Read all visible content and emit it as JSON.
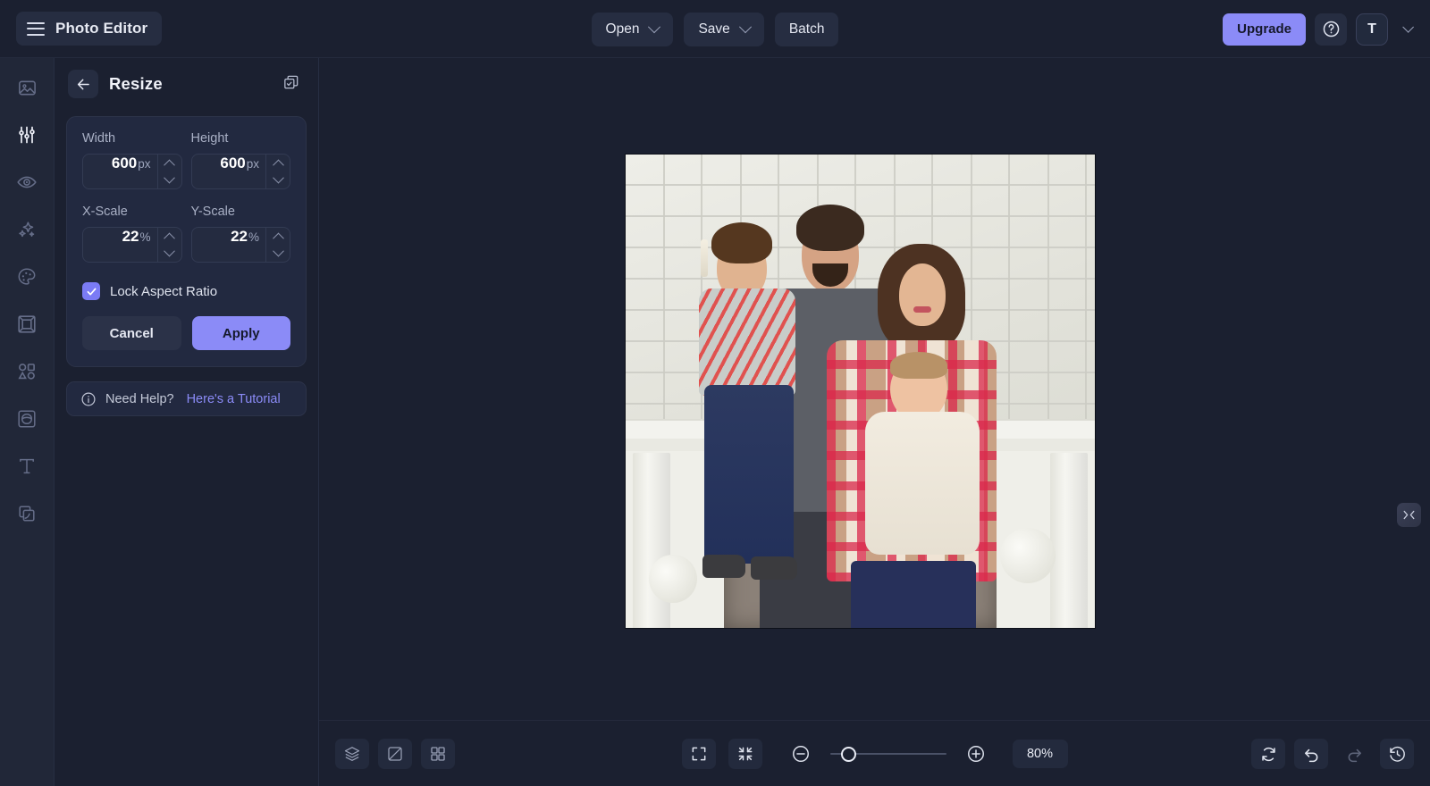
{
  "app": {
    "title": "Photo Editor",
    "accent": "#8b8bf7",
    "background": "#1b2030",
    "panel_bg": "#222940"
  },
  "topbar": {
    "menu_icon": "hamburger-icon",
    "brand_label": "Photo Editor",
    "buttons": [
      {
        "label": "Open",
        "has_chevron": true
      },
      {
        "label": "Save",
        "has_chevron": true
      },
      {
        "label": "Batch",
        "has_chevron": false
      }
    ],
    "upgrade_label": "Upgrade",
    "help_icon": "question-circle-icon",
    "avatar_initial": "T",
    "account_chevron": "chevron-down-icon"
  },
  "rail": {
    "items": [
      {
        "name": "image-tool",
        "icon": "image-icon",
        "active": false
      },
      {
        "name": "adjust-tool",
        "icon": "sliders-icon",
        "active": true
      },
      {
        "name": "retouch-tool",
        "icon": "eye-icon",
        "active": false
      },
      {
        "name": "effects-tool",
        "icon": "sparkles-icon",
        "active": false
      },
      {
        "name": "paint-tool",
        "icon": "palette-icon",
        "active": false
      },
      {
        "name": "frame-tool",
        "icon": "frame-icon",
        "active": false
      },
      {
        "name": "shapes-tool",
        "icon": "shapes-icon",
        "active": false
      },
      {
        "name": "mask-tool",
        "icon": "mask-icon",
        "active": false
      },
      {
        "name": "text-tool",
        "icon": "text-T-icon",
        "active": false
      },
      {
        "name": "layers-tool",
        "icon": "stacked-layers-icon",
        "active": false
      }
    ]
  },
  "panel": {
    "back_icon": "arrow-left-icon",
    "title": "Resize",
    "duplicate_icon": "copy-layers-icon",
    "fields": [
      {
        "label": "Width",
        "value": "600",
        "unit": "px"
      },
      {
        "label": "Height",
        "value": "600",
        "unit": "px"
      },
      {
        "label": "X-Scale",
        "value": "22",
        "unit": "%"
      },
      {
        "label": "Y-Scale",
        "value": "22",
        "unit": "%"
      }
    ],
    "lock_aspect_ratio": {
      "label": "Lock Aspect Ratio",
      "checked": true
    },
    "cancel_label": "Cancel",
    "apply_label": "Apply",
    "help": {
      "icon": "info-circle-icon",
      "text": "Need Help?",
      "link_text": "Here's a Tutorial"
    }
  },
  "canvas": {
    "collapse_handle_icon": "collapse-horizontal-icon",
    "image_alt": "family portrait in front of white brick wall and fireplace"
  },
  "bottombar": {
    "left_tools": [
      {
        "name": "layers-button",
        "icon": "layers-stack-icon"
      },
      {
        "name": "compare-button",
        "icon": "compare-split-icon"
      },
      {
        "name": "grid-button",
        "icon": "grid-four-icon"
      }
    ],
    "center_tools": [
      {
        "name": "fullscreen-button",
        "icon": "expand-corners-icon"
      },
      {
        "name": "fit-screen-button",
        "icon": "collapse-corners-icon"
      }
    ],
    "zoom_out_icon": "minus-circle-icon",
    "zoom_in_icon": "plus-circle-icon",
    "zoom_value": "80%",
    "zoom_percent": 80,
    "right_tools": [
      {
        "name": "reset-button",
        "icon": "refresh-cycle-icon",
        "disabled": false
      },
      {
        "name": "undo-button",
        "icon": "undo-arrow-icon",
        "disabled": false
      },
      {
        "name": "redo-button",
        "icon": "redo-arrow-icon",
        "disabled": true
      },
      {
        "name": "history-button",
        "icon": "clock-history-icon",
        "disabled": false
      }
    ]
  }
}
